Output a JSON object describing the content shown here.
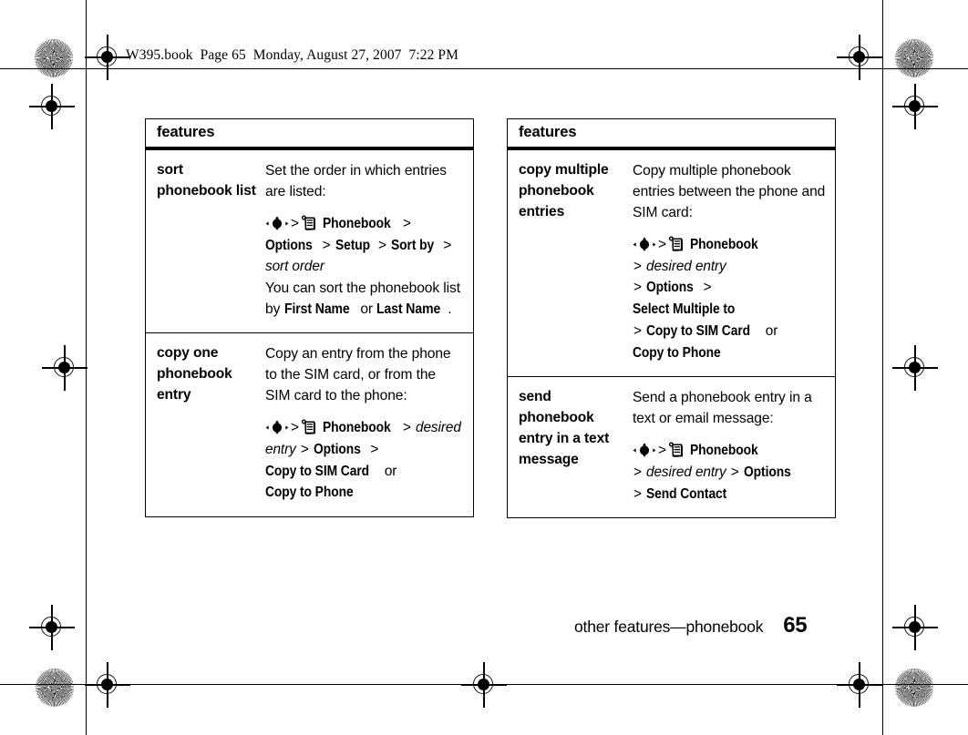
{
  "running_head": "W395.book  Page 65  Monday, August 27, 2007  7:22 PM",
  "tables": [
    {
      "id": "table-left",
      "header": "features",
      "rows": [
        {
          "term": "sort phonebook list",
          "blocks": [
            {
              "type": "text",
              "text": "Set the order in which entries are listed:"
            },
            {
              "type": "path",
              "segments": [
                {
                  "kind": "icon",
                  "icon": "nav-key-icon"
                },
                {
                  "kind": "sep",
                  "text": ">"
                },
                {
                  "kind": "icon",
                  "icon": "phonebook-icon"
                },
                {
                  "kind": "menu",
                  "text": "Phonebook"
                },
                {
                  "kind": "sep",
                  "text": ">"
                },
                {
                  "kind": "menu",
                  "text": "Options"
                },
                {
                  "kind": "sep",
                  "text": ">"
                },
                {
                  "kind": "menu",
                  "text": "Setup"
                },
                {
                  "kind": "sep",
                  "text": ">"
                },
                {
                  "kind": "menu",
                  "text": "Sort by"
                },
                {
                  "kind": "sep",
                  "text": ">"
                },
                {
                  "kind": "var",
                  "text": "sort order"
                }
              ]
            },
            {
              "type": "mixed",
              "parts": [
                {
                  "kind": "plain",
                  "text": "You can sort the phonebook list by "
                },
                {
                  "kind": "menu",
                  "text": "First Name"
                },
                {
                  "kind": "plain",
                  "text": " or "
                },
                {
                  "kind": "menu",
                  "text": "Last Name"
                },
                {
                  "kind": "plain",
                  "text": "."
                }
              ]
            }
          ]
        },
        {
          "term": "copy one phonebook entry",
          "blocks": [
            {
              "type": "text",
              "text": "Copy an entry from the phone to the SIM card, or from the SIM card to the phone:"
            },
            {
              "type": "path",
              "segments": [
                {
                  "kind": "icon",
                  "icon": "nav-key-icon"
                },
                {
                  "kind": "sep",
                  "text": ">"
                },
                {
                  "kind": "icon",
                  "icon": "phonebook-icon"
                },
                {
                  "kind": "menu",
                  "text": "Phonebook"
                },
                {
                  "kind": "sep",
                  "text": ">"
                },
                {
                  "kind": "var",
                  "text": "desired entry"
                },
                {
                  "kind": "sep",
                  "text": ">"
                },
                {
                  "kind": "menu",
                  "text": "Options"
                },
                {
                  "kind": "sep",
                  "text": ">"
                },
                {
                  "kind": "menu",
                  "text": "Copy to SIM Card"
                },
                {
                  "kind": "plain",
                  "text": " or "
                },
                {
                  "kind": "menu",
                  "text": "Copy to Phone"
                }
              ]
            }
          ]
        }
      ]
    },
    {
      "id": "table-right",
      "header": "features",
      "rows": [
        {
          "term": "copy multiple phonebook entries",
          "blocks": [
            {
              "type": "text",
              "text": "Copy multiple phonebook entries between the phone and SIM card:"
            },
            {
              "type": "path",
              "segments": [
                {
                  "kind": "icon",
                  "icon": "nav-key-icon"
                },
                {
                  "kind": "sep",
                  "text": ">"
                },
                {
                  "kind": "icon",
                  "icon": "phonebook-icon"
                },
                {
                  "kind": "menu",
                  "text": "Phonebook"
                },
                {
                  "kind": "break"
                },
                {
                  "kind": "sep",
                  "text": ">"
                },
                {
                  "kind": "var",
                  "text": "desired entry"
                },
                {
                  "kind": "break"
                },
                {
                  "kind": "sep",
                  "text": ">"
                },
                {
                  "kind": "menu",
                  "text": "Options"
                },
                {
                  "kind": "sep",
                  "text": ">"
                },
                {
                  "kind": "menu",
                  "text": "Select Multiple to"
                },
                {
                  "kind": "break"
                },
                {
                  "kind": "sep",
                  "text": ">"
                },
                {
                  "kind": "menu",
                  "text": "Copy to SIM Card"
                },
                {
                  "kind": "plain",
                  "text": " or"
                },
                {
                  "kind": "break"
                },
                {
                  "kind": "menu",
                  "text": "Copy to Phone"
                }
              ]
            }
          ]
        },
        {
          "term": "send phonebook entry in a text message",
          "blocks": [
            {
              "type": "text",
              "text": "Send a phonebook entry in a text or email message:"
            },
            {
              "type": "path",
              "segments": [
                {
                  "kind": "icon",
                  "icon": "nav-key-icon"
                },
                {
                  "kind": "sep",
                  "text": ">"
                },
                {
                  "kind": "icon",
                  "icon": "phonebook-icon"
                },
                {
                  "kind": "menu",
                  "text": "Phonebook"
                },
                {
                  "kind": "break"
                },
                {
                  "kind": "sep",
                  "text": ">"
                },
                {
                  "kind": "var",
                  "text": "desired entry"
                },
                {
                  "kind": "sep",
                  "text": ">"
                },
                {
                  "kind": "menu",
                  "text": "Options"
                },
                {
                  "kind": "break"
                },
                {
                  "kind": "sep",
                  "text": ">"
                },
                {
                  "kind": "menu",
                  "text": "Send Contact"
                }
              ]
            }
          ]
        }
      ]
    }
  ],
  "footer": {
    "title": "other features—phonebook",
    "page_number": "65"
  },
  "colors": {
    "ink": "#000000",
    "page": "#ffffff"
  }
}
